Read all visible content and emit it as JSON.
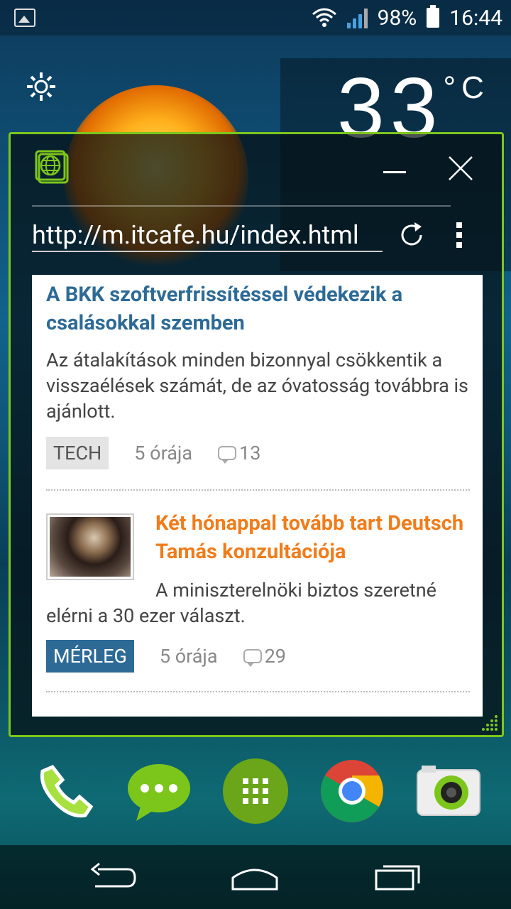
{
  "status_bar": {
    "battery_percent": "98%",
    "time": "16:44"
  },
  "weather_widget": {
    "temperature": "33",
    "unit": "°C"
  },
  "browser": {
    "url": "http://m.itcafe.hu/index.html"
  },
  "articles": [
    {
      "title": "A BKK szoftverfrissítéssel védekezik a csalásokkal szemben",
      "description": "Az átalakítások minden bizonnyal csökkentik a visszaélések számát, de az óvatosság továbbra is ajánlott.",
      "tag": "TECH",
      "time": "5 órája",
      "comments": "13"
    },
    {
      "title": "Két hónappal tovább tart Deutsch Tamás konzultációja",
      "description": "A miniszterelnöki biztos szeretné elérni a 30 ezer választ.",
      "tag": "MÉRLEG",
      "time": "5 órája",
      "comments": "29"
    }
  ],
  "colors": {
    "window_border": "#7cc61c",
    "title_blue": "#2d6a96",
    "title_orange": "#f07c1a"
  }
}
